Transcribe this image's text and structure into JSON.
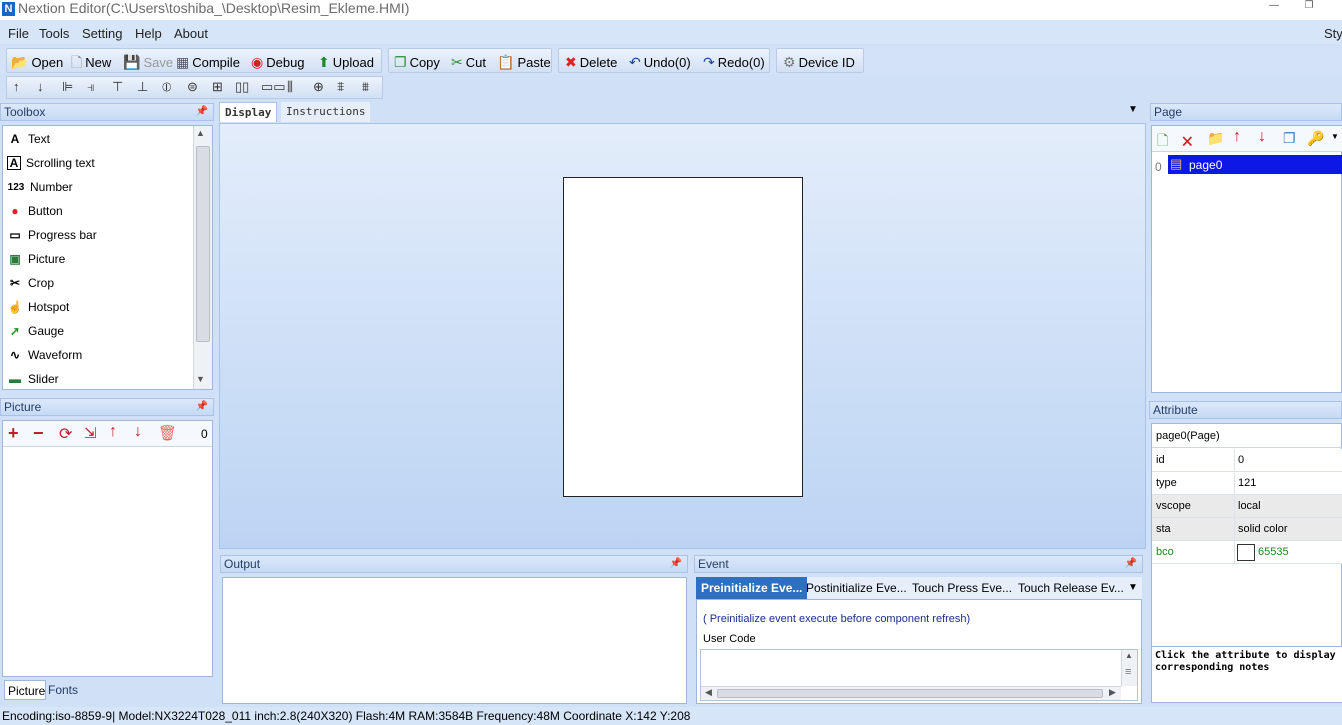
{
  "window": {
    "title": "Nextion Editor(C:\\Users\\toshiba_\\Desktop\\Resim_Ekleme.HMI)",
    "logo": "N",
    "minimize": "—",
    "restore": "❐"
  },
  "menu": {
    "items": [
      "File",
      "Tools",
      "Setting",
      "Help",
      "About"
    ],
    "right": "Sty"
  },
  "toolbar": {
    "open": "Open",
    "new": "New",
    "save": "Save",
    "compile": "Compile",
    "debug": "Debug",
    "upload": "Upload",
    "copy": "Copy",
    "cut": "Cut",
    "paste": "Paste",
    "delete": "Delete",
    "undo": "Undo(0)",
    "redo": "Redo(0)",
    "device_id": "Device  ID"
  },
  "toolbox": {
    "header": "Toolbox",
    "items": [
      {
        "label": "Text",
        "icon": "text-icon",
        "glyph": "A"
      },
      {
        "label": "Scrolling text",
        "icon": "scrolling-text-icon",
        "glyph": "A"
      },
      {
        "label": "Number",
        "icon": "number-icon",
        "glyph": "123"
      },
      {
        "label": "Button",
        "icon": "button-icon",
        "glyph": "●"
      },
      {
        "label": "Progress bar",
        "icon": "progress-bar-icon",
        "glyph": "▭"
      },
      {
        "label": "Picture",
        "icon": "picture-icon",
        "glyph": "▣"
      },
      {
        "label": "Crop",
        "icon": "crop-icon",
        "glyph": "✂"
      },
      {
        "label": "Hotspot",
        "icon": "hotspot-icon",
        "glyph": "☝"
      },
      {
        "label": "Gauge",
        "icon": "gauge-icon",
        "glyph": "➚"
      },
      {
        "label": "Waveform",
        "icon": "waveform-icon",
        "glyph": "∿"
      },
      {
        "label": "Slider",
        "icon": "slider-icon",
        "glyph": "▬"
      }
    ]
  },
  "picture_panel": {
    "header": "Picture",
    "count": "0",
    "tabs": [
      "Picture",
      "Fonts"
    ]
  },
  "display": {
    "tabs": [
      "Display",
      "Instructions"
    ]
  },
  "page_panel": {
    "header": "Page",
    "pages": [
      {
        "index": "0",
        "name": "page0"
      }
    ]
  },
  "attribute_panel": {
    "header": "Attribute",
    "selected": "page0(Page)",
    "rows": [
      {
        "name": "id",
        "value": "0"
      },
      {
        "name": "type",
        "value": "121"
      },
      {
        "name": "vscope",
        "value": "local"
      },
      {
        "name": "sta",
        "value": "solid color"
      },
      {
        "name": "bco",
        "value": "65535"
      }
    ],
    "note": "Click the attribute to display corresponding notes"
  },
  "output_panel": {
    "header": "Output"
  },
  "event_panel": {
    "header": "Event",
    "tabs": [
      "Preinitialize Eve...",
      "Postinitialize Eve...",
      "Touch Press Eve...",
      "Touch Release Ev..."
    ],
    "description": "( Preinitialize event execute before component refresh)",
    "user_code_label": "User Code"
  },
  "status_bar": {
    "text": "Encoding:iso-8859-9| Model:NX3224T028_011  inch:2.8(240X320) Flash:4M RAM:3584B Frequency:48M     Coordinate X:142  Y:208"
  },
  "colors": {
    "selected": "#0b18e6",
    "accent": "#2f6fc0",
    "bco_text": "#1a8a1a"
  }
}
